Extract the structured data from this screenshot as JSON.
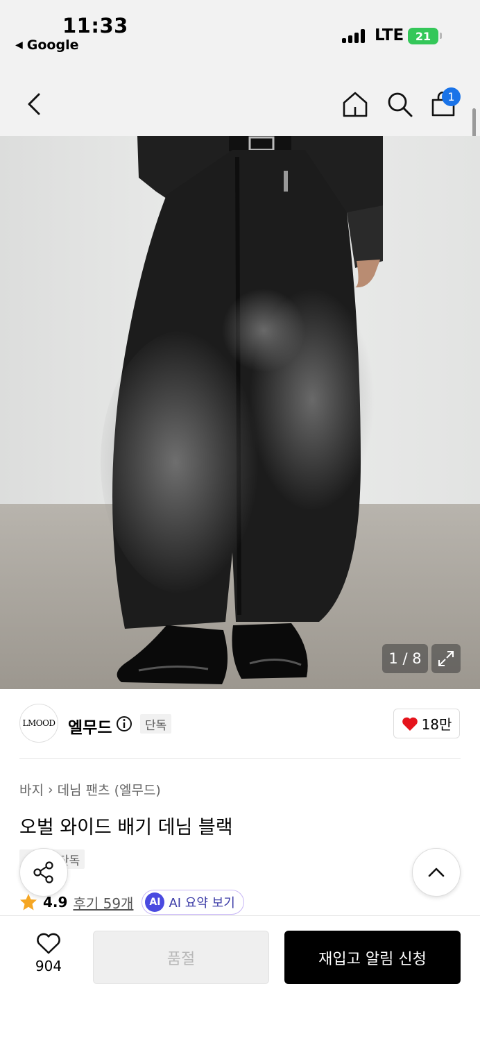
{
  "status_bar": {
    "time": "11:33",
    "back_app": "Google",
    "network": "LTE",
    "battery": "21"
  },
  "header": {
    "cart_count": "1",
    "icons": [
      "back-arrow-icon",
      "home-icon",
      "search-icon",
      "cart-icon"
    ]
  },
  "gallery": {
    "counter": "1 / 8",
    "current": 1,
    "total": 8
  },
  "brand": {
    "logo_text": "LMOOD",
    "name": "엘무드",
    "tag": "단독",
    "likes": "18만"
  },
  "product": {
    "breadcrumb": [
      "바지",
      "데님 팬츠 (엘무드)"
    ],
    "title": "오벌 와이드 배기 데님 블랙",
    "tag": "단독",
    "rating": "4.9",
    "reviews": "후기 59개",
    "ai_badge": "AI",
    "ai_summary": "AI 요약 보기"
  },
  "bottom_bar": {
    "wish_count": "904",
    "soldout_label": "품절",
    "restock_label": "재입고 알림 신청"
  },
  "colors": {
    "badge_blue": "#1a73e8",
    "battery_green": "#34c759",
    "heart_red": "#e5141c",
    "star_orange": "#f5a623",
    "ai_purple": "#4a4ae0"
  }
}
